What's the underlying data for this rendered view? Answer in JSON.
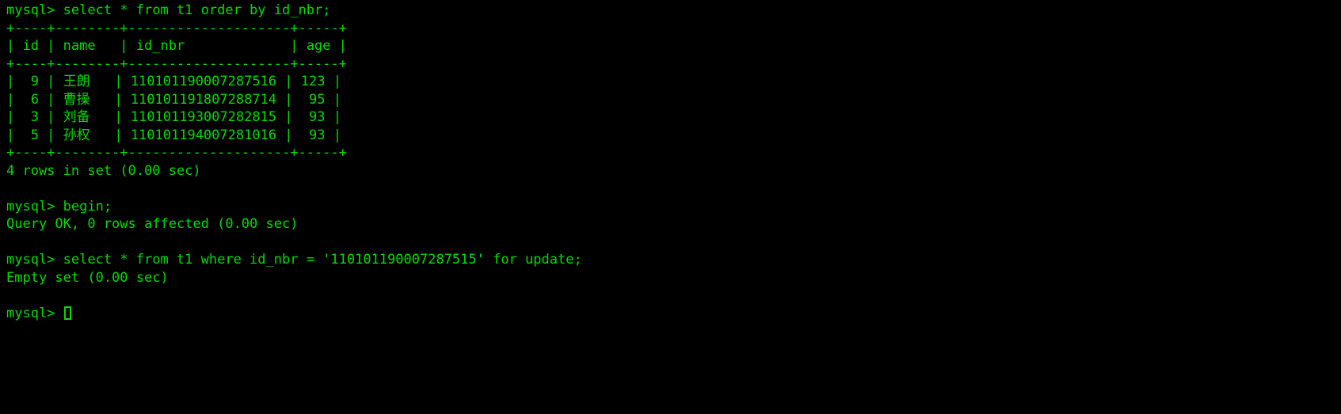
{
  "terminal": {
    "foreground_color": "#00dd00",
    "background_color": "#000000",
    "prompt": "mysql>",
    "lines": [
      "mysql> select * from t1 order by id_nbr;",
      "+----+--------+--------------------+-----+",
      "| id | name   | id_nbr             | age |",
      "+----+--------+--------------------+-----+",
      "|  9 | 王朗   | 110101190007287516 | 123 |",
      "|  6 | 曹操   | 110101191807288714 |  95 |",
      "|  3 | 刘备   | 110101193007282815 |  93 |",
      "|  5 | 孙权   | 110101194007281016 |  93 |",
      "+----+--------+--------------------+-----+",
      "4 rows in set (0.00 sec)",
      "",
      "mysql> begin;",
      "Query OK, 0 rows affected (0.00 sec)",
      "",
      "mysql> select * from t1 where id_nbr = '110101190007287515' for update;",
      "Empty set (0.00 sec)",
      ""
    ],
    "final_prompt": "mysql> ",
    "cursor": "block-cursor"
  },
  "result_table": {
    "columns": [
      "id",
      "name",
      "id_nbr",
      "age"
    ],
    "rows": [
      {
        "id": "9",
        "name": "王朗",
        "id_nbr": "110101190007287516",
        "age": "123"
      },
      {
        "id": "6",
        "name": "曹操",
        "id_nbr": "110101191807288714",
        "age": "95"
      },
      {
        "id": "3",
        "name": "刘备",
        "id_nbr": "110101193007282815",
        "age": "93"
      },
      {
        "id": "5",
        "name": "孙权",
        "id_nbr": "110101194007281016",
        "age": "93"
      }
    ],
    "row_count_text": "4 rows in set (0.00 sec)"
  },
  "statements": [
    {
      "sql": "select * from t1 order by id_nbr;",
      "result": "4 rows in set (0.00 sec)"
    },
    {
      "sql": "begin;",
      "result": "Query OK, 0 rows affected (0.00 sec)"
    },
    {
      "sql": "select * from t1 where id_nbr = '110101190007287515' for update;",
      "result": "Empty set (0.00 sec)"
    }
  ],
  "overlay": {
    "top_bar_color": "#1d1d1d"
  }
}
